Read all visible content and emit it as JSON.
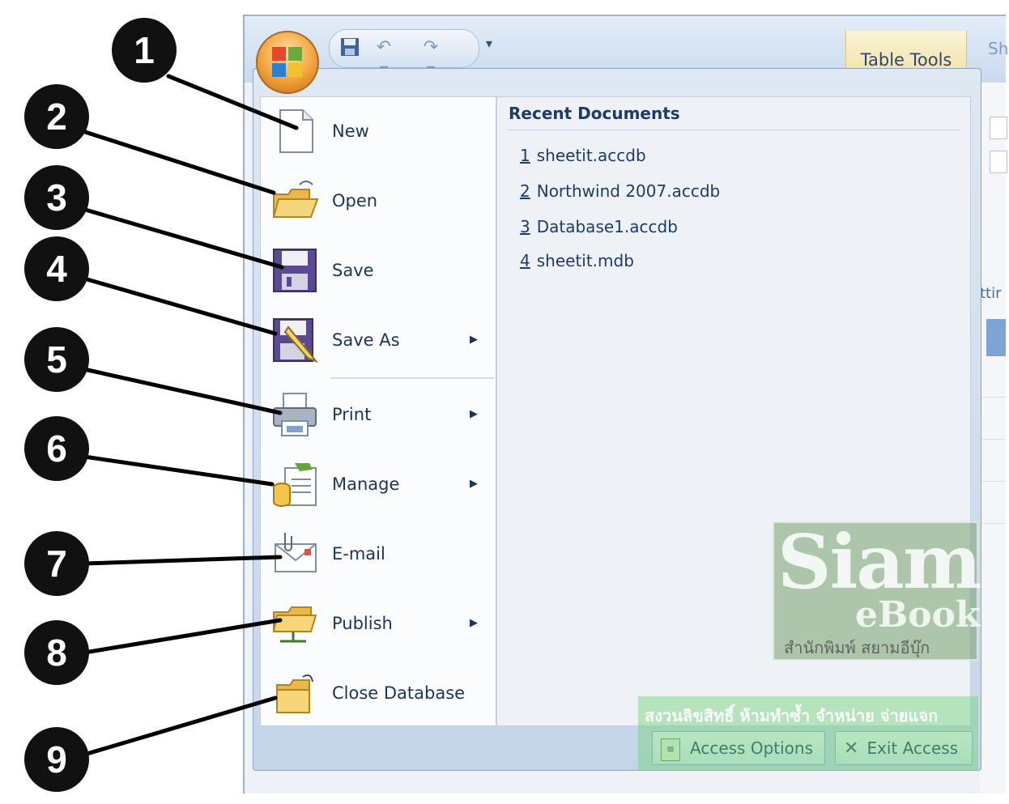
{
  "qat": {
    "save_icon": "save-icon",
    "undo_icon": "undo-icon",
    "redo_icon": "redo-icon",
    "dropdown_glyph": "▾"
  },
  "ribbon": {
    "context_tab": "Table Tools",
    "cutoff_tab": "Sh",
    "side_fragment": "ttir"
  },
  "office_button": {
    "icon": "office-logo-icon"
  },
  "menu": {
    "items": [
      {
        "label": "New",
        "icon": "new-document-icon",
        "submenu": false
      },
      {
        "label": "Open",
        "icon": "open-folder-icon",
        "submenu": false
      },
      {
        "label": "Save",
        "icon": "save-icon",
        "submenu": false
      },
      {
        "label": "Save As",
        "icon": "save-as-icon",
        "submenu": true
      },
      {
        "label": "Print",
        "icon": "printer-icon",
        "submenu": true
      },
      {
        "label": "Manage",
        "icon": "manage-icon",
        "submenu": true
      },
      {
        "label": "E-mail",
        "icon": "email-icon",
        "submenu": false
      },
      {
        "label": "Publish",
        "icon": "publish-icon",
        "submenu": true
      },
      {
        "label": "Close Database",
        "icon": "close-database-icon",
        "submenu": false
      }
    ],
    "submenu_arrow": "▶"
  },
  "recent": {
    "title": "Recent Documents",
    "items": [
      {
        "num": "1",
        "name": "sheetit.accdb"
      },
      {
        "num": "2",
        "name": "Northwind 2007.accdb"
      },
      {
        "num": "3",
        "name": "Database1.accdb"
      },
      {
        "num": "4",
        "name": "sheetit.mdb"
      }
    ]
  },
  "footer": {
    "options_label": "Access Options",
    "exit_label": "Exit Access",
    "exit_glyph": "✕"
  },
  "watermark": {
    "brand_large": "Siam",
    "brand_small": "eBook",
    "brand_thai": "สำนักพิมพ์ สยามอีบุ๊ก",
    "banner": "สงวนลิขสิทธิ์ ห้ามทำซ้ำ จำหน่าย จ่ายแจก"
  },
  "callouts": [
    "1",
    "2",
    "3",
    "4",
    "5",
    "6",
    "7",
    "8",
    "9"
  ]
}
